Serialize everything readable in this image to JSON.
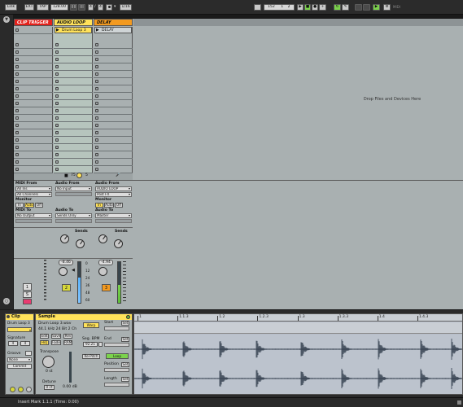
{
  "colors": {
    "clip_trigger": "#e4211b",
    "audio_loop": "#ffe25a",
    "delay": "#f39a20",
    "session_bg": "#a9b0b1",
    "wave_bg": "#b7bec9",
    "status_yellow": "#d8d83a"
  },
  "transport": {
    "link": "Link",
    "ext": "EXT",
    "tap": "TAP",
    "tempo": "128.00",
    "nudge_a": "||||",
    "nudge_b": "|||",
    "sig_num": "4",
    "sig_den": "4",
    "metro_icon": "metronome-icon",
    "quant": "1/16",
    "position": [
      "152",
      "1",
      "2"
    ],
    "midi_label": "MIDI"
  },
  "tracks": [
    {
      "name": "CLIP TRIGGER"
    },
    {
      "name": "AUDIO LOOP"
    },
    {
      "name": "DELAY"
    }
  ],
  "clips": {
    "audio_loop_first": "Drum Loop 3",
    "delay_first": "DELAY"
  },
  "drop_text": "Drop Files and Devices Here",
  "io": {
    "t1": {
      "midi_from": "MIDI From",
      "midi_from_val": "All Ins",
      "channel_val": "All Channels",
      "monitor": "Monitor",
      "mon_in": "In",
      "mon_auto": "Auto",
      "mon_off": "Off",
      "midi_to": "MIDI To",
      "midi_to_val": "No Output"
    },
    "t2": {
      "audio_from": "Audio From",
      "audio_from_val": "No Input",
      "audio_to": "Audio To",
      "audio_to_val": "Sends Only",
      "sends": "Sends"
    },
    "t3": {
      "audio_from": "Audio From",
      "audio_from_val": "AUDIO LOOP",
      "post_fx": "Post FX",
      "monitor": "Monitor",
      "mon_in": "In",
      "mon_auto": "Auto",
      "mon_off": "Off",
      "audio_to": "Audio To",
      "audio_to_val": "Master",
      "sends": "Sends"
    }
  },
  "mixer": {
    "t2_vol": "-8.46",
    "t3_vol": "-4.94",
    "t1_num": "1",
    "t2_num": "2",
    "t3_num": "3",
    "solo": "S",
    "scale": [
      "0",
      "12",
      "24",
      "36",
      "48",
      "60"
    ],
    "t2_meter_level": 0.62,
    "t3_meter_level": 0.45
  },
  "clip_view": {
    "clip_tab": "Clip",
    "clip_name": "Drum Loop 3",
    "signature": "Signature",
    "sig_num": "4",
    "sig_den": "4",
    "groove": "Groove",
    "groove_val": "None",
    "commit": "Commit",
    "sample_tab": "Sample",
    "sample_file": "Drum Loop 3.wav",
    "sample_info": "44.1 kHz 24 Bit 2 Ch",
    "edit": "Edit",
    "save": "Save",
    "rev": "Rev",
    "hiq": "HiQ",
    "fade": "Fade",
    "ram": "RAM",
    "transpose": "Transpose",
    "transpose_val": "0 st",
    "detune": "Detune",
    "detune_val": "0 ct",
    "gain_val": "0.00 dB",
    "warp": "Warp",
    "seg_bpm": "Seg. BPM",
    "bpm_val": "92.21",
    "beats": "Beats",
    "re_pitch": "Re-Pitch",
    "start": "Start",
    "end": "End",
    "loop": "Loop",
    "position": "Position",
    "length": "Length",
    "set": "Set",
    "ruler": [
      "1",
      "1.1.3",
      "1.2",
      "1.2.3",
      "1.3",
      "1.3.3",
      "1.4",
      "1.4.3"
    ]
  },
  "status_bar": {
    "text": "Insert Mark 1.1.1 (Time: 0:00)"
  }
}
